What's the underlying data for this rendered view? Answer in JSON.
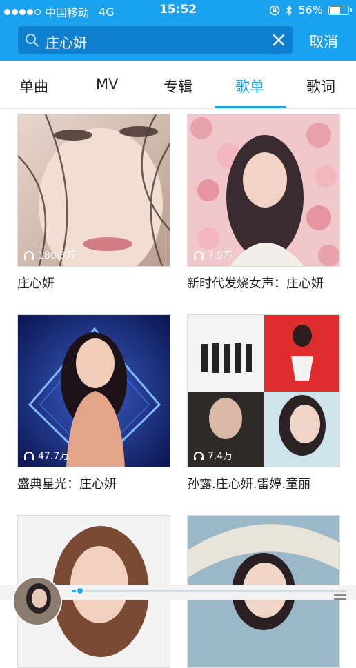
{
  "status_bar": {
    "carrier": "中国移动",
    "network": "4G",
    "time": "15:52",
    "battery": "56%",
    "battery_level": 0.56
  },
  "search": {
    "query": "庄心妍",
    "cancel_label": "取消"
  },
  "tabs": [
    {
      "label": "单曲"
    },
    {
      "label": "MV"
    },
    {
      "label": "专辑"
    },
    {
      "label": "歌单"
    },
    {
      "label": "歌词"
    }
  ],
  "active_tab": "歌单",
  "playlists": [
    {
      "title": "庄心妍",
      "plays": "186.3万"
    },
    {
      "title": "新时代发烧女声：庄心妍",
      "plays": "7.5万"
    },
    {
      "title": "盛典星光：庄心妍",
      "plays": "47.7万"
    },
    {
      "title": "孙露.庄心妍.雷婷.童丽",
      "plays": "7.4万"
    },
    {
      "title": "",
      "plays": ""
    },
    {
      "title": "",
      "plays": ""
    }
  ],
  "player": {
    "progress": 0.03
  },
  "colors": {
    "accent": "#1aa2ee",
    "header": "#1aa2ee",
    "search_box": "#0f7fd0"
  }
}
